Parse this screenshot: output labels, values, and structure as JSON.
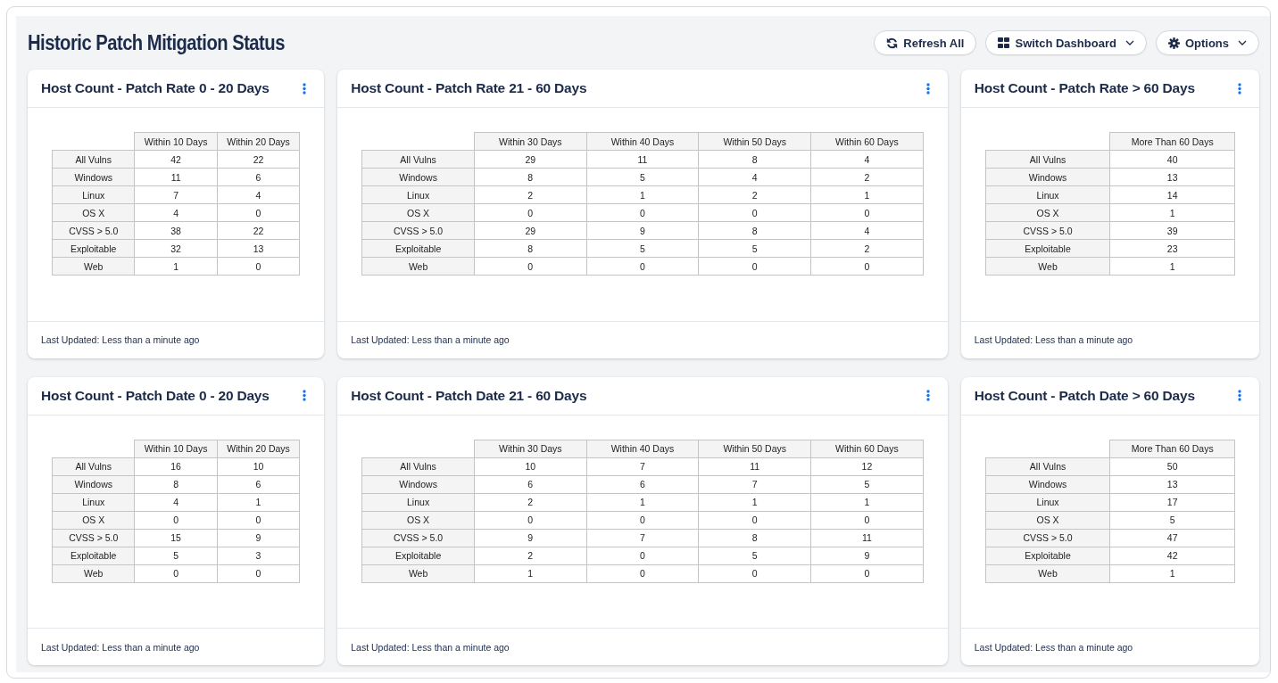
{
  "title": "Historic Patch Mitigation Status",
  "buttons": [
    {
      "label": "Refresh All",
      "kind": "refresh",
      "dropdown": false
    },
    {
      "label": "Switch Dashboard",
      "kind": "switch",
      "dropdown": true
    },
    {
      "label": "Options",
      "kind": "options",
      "dropdown": true
    }
  ],
  "cards": [
    {
      "title": "Host Count - Patch Rate 0 - 20 Days",
      "columns": [
        "Within 10 Days",
        "Within 20 Days"
      ],
      "rows": [
        {
          "label": "All Vulns",
          "values": [
            "42",
            "22"
          ]
        },
        {
          "label": "Windows",
          "values": [
            "11",
            "6"
          ]
        },
        {
          "label": "Linux",
          "values": [
            "7",
            "4"
          ]
        },
        {
          "label": "OS X",
          "values": [
            "4",
            "0"
          ]
        },
        {
          "label": "CVSS > 5.0",
          "values": [
            "38",
            "22"
          ]
        },
        {
          "label": "Exploitable",
          "values": [
            "32",
            "13"
          ]
        },
        {
          "label": "Web",
          "values": [
            "1",
            "0"
          ]
        }
      ],
      "footer": "Last Updated: Less than a minute ago"
    },
    {
      "title": "Host Count - Patch Rate 21 - 60 Days",
      "columns": [
        "Within 30 Days",
        "Within 40 Days",
        "Within 50 Days",
        "Within 60 Days"
      ],
      "rows": [
        {
          "label": "All Vulns",
          "values": [
            "29",
            "11",
            "8",
            "4"
          ]
        },
        {
          "label": "Windows",
          "values": [
            "8",
            "5",
            "4",
            "2"
          ]
        },
        {
          "label": "Linux",
          "values": [
            "2",
            "1",
            "2",
            "1"
          ]
        },
        {
          "label": "OS X",
          "values": [
            "0",
            "0",
            "0",
            "0"
          ]
        },
        {
          "label": "CVSS > 5.0",
          "values": [
            "29",
            "9",
            "8",
            "4"
          ]
        },
        {
          "label": "Exploitable",
          "values": [
            "8",
            "5",
            "5",
            "2"
          ]
        },
        {
          "label": "Web",
          "values": [
            "0",
            "0",
            "0",
            "0"
          ]
        }
      ],
      "footer": "Last Updated: Less than a minute ago"
    },
    {
      "title": "Host Count - Patch Rate > 60 Days",
      "columns": [
        "More Than 60 Days"
      ],
      "rows": [
        {
          "label": "All Vulns",
          "values": [
            "40"
          ]
        },
        {
          "label": "Windows",
          "values": [
            "13"
          ]
        },
        {
          "label": "Linux",
          "values": [
            "14"
          ]
        },
        {
          "label": "OS X",
          "values": [
            "1"
          ]
        },
        {
          "label": "CVSS > 5.0",
          "values": [
            "39"
          ]
        },
        {
          "label": "Exploitable",
          "values": [
            "23"
          ]
        },
        {
          "label": "Web",
          "values": [
            "1"
          ]
        }
      ],
      "footer": "Last Updated: Less than a minute ago"
    },
    {
      "title": "Host Count - Patch Date 0 - 20 Days",
      "columns": [
        "Within 10 Days",
        "Within 20 Days"
      ],
      "rows": [
        {
          "label": "All Vulns",
          "values": [
            "16",
            "10"
          ]
        },
        {
          "label": "Windows",
          "values": [
            "8",
            "6"
          ]
        },
        {
          "label": "Linux",
          "values": [
            "4",
            "1"
          ]
        },
        {
          "label": "OS X",
          "values": [
            "0",
            "0"
          ]
        },
        {
          "label": "CVSS > 5.0",
          "values": [
            "15",
            "9"
          ]
        },
        {
          "label": "Exploitable",
          "values": [
            "5",
            "3"
          ]
        },
        {
          "label": "Web",
          "values": [
            "0",
            "0"
          ]
        }
      ],
      "footer": "Last Updated: Less than a minute ago"
    },
    {
      "title": "Host Count - Patch Date 21 - 60 Days",
      "columns": [
        "Within 30 Days",
        "Within 40 Days",
        "Within 50 Days",
        "Within 60 Days"
      ],
      "rows": [
        {
          "label": "All Vulns",
          "values": [
            "10",
            "7",
            "11",
            "12"
          ]
        },
        {
          "label": "Windows",
          "values": [
            "6",
            "6",
            "7",
            "5"
          ]
        },
        {
          "label": "Linux",
          "values": [
            "2",
            "1",
            "1",
            "1"
          ]
        },
        {
          "label": "OS X",
          "values": [
            "0",
            "0",
            "0",
            "0"
          ]
        },
        {
          "label": "CVSS > 5.0",
          "values": [
            "9",
            "7",
            "8",
            "11"
          ]
        },
        {
          "label": "Exploitable",
          "values": [
            "2",
            "0",
            "5",
            "9"
          ]
        },
        {
          "label": "Web",
          "values": [
            "1",
            "0",
            "0",
            "0"
          ]
        }
      ],
      "footer": "Last Updated: Less than a minute ago"
    },
    {
      "title": "Host Count - Patch Date > 60 Days",
      "columns": [
        "More Than 60 Days"
      ],
      "rows": [
        {
          "label": "All Vulns",
          "values": [
            "50"
          ]
        },
        {
          "label": "Windows",
          "values": [
            "13"
          ]
        },
        {
          "label": "Linux",
          "values": [
            "17"
          ]
        },
        {
          "label": "OS X",
          "values": [
            "5"
          ]
        },
        {
          "label": "CVSS > 5.0",
          "values": [
            "47"
          ]
        },
        {
          "label": "Exploitable",
          "values": [
            "42"
          ]
        },
        {
          "label": "Web",
          "values": [
            "1"
          ]
        }
      ],
      "footer": "Last Updated: Less than a minute ago"
    }
  ]
}
